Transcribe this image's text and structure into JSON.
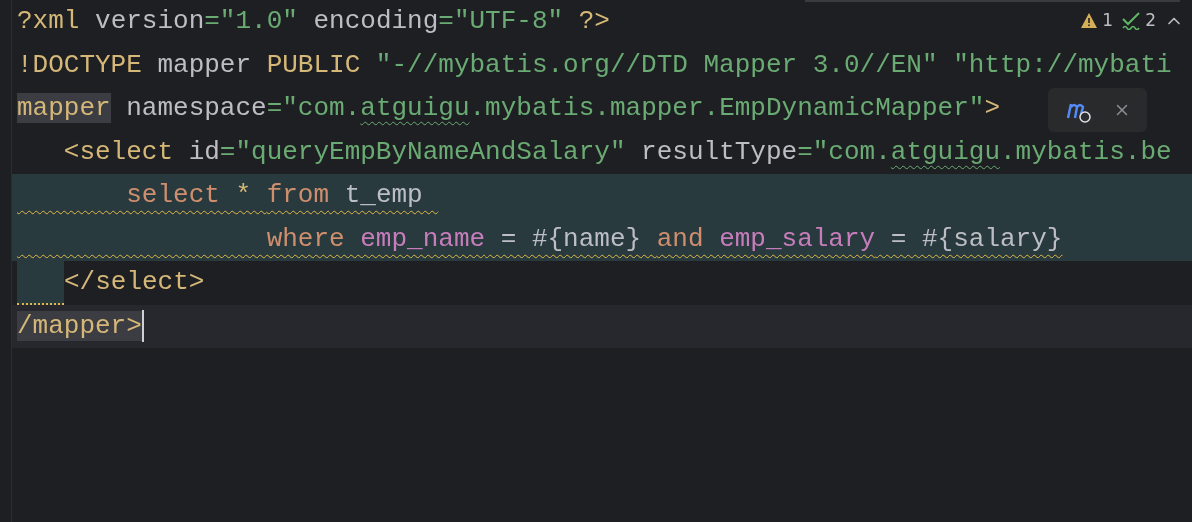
{
  "editor": {
    "lines": [
      {
        "current": false,
        "injected": false,
        "warning": false,
        "injected_indent": false,
        "tokens": [
          {
            "t": "?xml",
            "kind": "tag"
          },
          {
            "t": " version",
            "kind": "attr"
          },
          {
            "t": "=\"1.0\"",
            "kind": "value"
          },
          {
            "t": " encoding",
            "kind": "attr"
          },
          {
            "t": "=\"UTF-8\"",
            "kind": "value"
          },
          {
            "t": " ?>",
            "kind": "tag"
          }
        ]
      },
      {
        "current": false,
        "injected": false,
        "warning": false,
        "injected_indent": false,
        "tokens": [
          {
            "t": "!DOCTYPE",
            "kind": "tag"
          },
          {
            "t": " mapper",
            "kind": "plain"
          },
          {
            "t": " PUBLIC",
            "kind": "tag"
          },
          {
            "t": " \"-//mybatis.org//DTD Mapper 3.0//EN\" \"http://mybati",
            "kind": "value"
          }
        ]
      },
      {
        "current": false,
        "injected": false,
        "warning": false,
        "injected_indent": false,
        "tokens": [
          {
            "t": "mapper",
            "kind": "tag",
            "match": true
          },
          {
            "t": " namespace",
            "kind": "attr"
          },
          {
            "t": "=\"com.",
            "kind": "value"
          },
          {
            "t": "atguigu",
            "kind": "value",
            "typo": true
          },
          {
            "t": ".mybatis.mapper.EmpDynamicMapper\"",
            "kind": "value"
          },
          {
            "t": ">",
            "kind": "tag"
          }
        ]
      },
      {
        "current": false,
        "injected": false,
        "warning": false,
        "injected_indent": false,
        "tokens": [
          {
            "t": "   <select",
            "kind": "tag"
          },
          {
            "t": " id",
            "kind": "attr"
          },
          {
            "t": "=\"queryEmpByNameAndSalary\"",
            "kind": "value"
          },
          {
            "t": " resultType",
            "kind": "attr"
          },
          {
            "t": "=\"com.",
            "kind": "value"
          },
          {
            "t": "atguigu",
            "kind": "value",
            "typo": true
          },
          {
            "t": ".mybatis.be",
            "kind": "value"
          }
        ]
      },
      {
        "current": false,
        "injected": true,
        "warning": true,
        "injected_indent": false,
        "tokens": [
          {
            "t": "       select ",
            "kind": "kw"
          },
          {
            "t": "* ",
            "kind": "tag"
          },
          {
            "t": "from",
            "kind": "kw"
          },
          {
            "t": " t_emp ",
            "kind": "plain"
          }
        ]
      },
      {
        "current": false,
        "injected": true,
        "warning": true,
        "injected_indent": false,
        "tokens": [
          {
            "t": "                where ",
            "kind": "kw"
          },
          {
            "t": "emp_name",
            "kind": "col"
          },
          {
            "t": " = #{name} ",
            "kind": "plain"
          },
          {
            "t": "and ",
            "kind": "kw"
          },
          {
            "t": "emp_salary",
            "kind": "col"
          },
          {
            "t": " = #{salary}",
            "kind": "plain"
          }
        ]
      },
      {
        "current": false,
        "injected": false,
        "warning": false,
        "injected_indent": true,
        "tokens": [
          {
            "t": "</select>",
            "kind": "tag"
          }
        ]
      },
      {
        "current": true,
        "injected": false,
        "warning": false,
        "injected_indent": false,
        "tokens": [
          {
            "t": "/mapper>",
            "kind": "tag",
            "match": true
          }
        ]
      }
    ]
  },
  "inspections": [
    {
      "kind": "warning",
      "count": "1"
    },
    {
      "kind": "weak",
      "count": "2"
    }
  ]
}
